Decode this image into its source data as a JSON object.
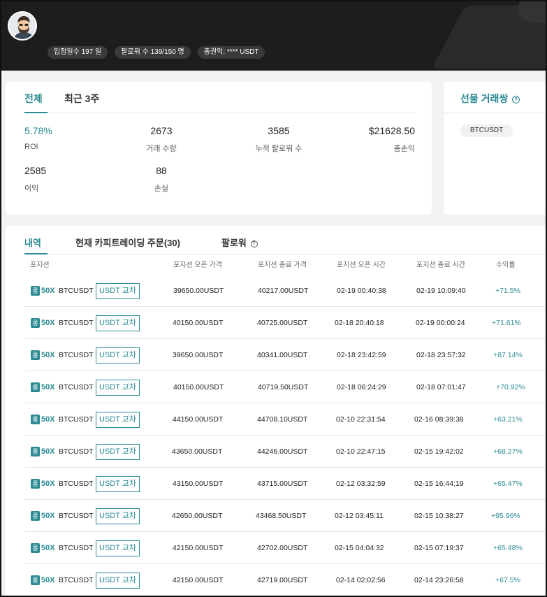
{
  "header": {
    "badges": [
      "입점일수 197 일",
      "팔로워 수 139/150 명",
      "총권익:  **** USDT"
    ]
  },
  "stats": {
    "tabs": [
      "전체",
      "최근 3주"
    ],
    "items": [
      {
        "value": "5.78%",
        "label": "ROI"
      },
      {
        "value": "2673",
        "label": "거래 수량"
      },
      {
        "value": "3585",
        "label": "누적 팔로워 수"
      },
      {
        "value": "$21628.50",
        "label": "총손익"
      },
      {
        "value": "2585",
        "label": "이익"
      },
      {
        "value": "88",
        "label": "손실"
      }
    ]
  },
  "pairs": {
    "title": "선물 거래쌍",
    "help_icon": "?",
    "chips": [
      "BTCUSDT"
    ]
  },
  "history": {
    "tabs": [
      "내역",
      "현재 카피트레이딩 주문(30)",
      "팔로워"
    ],
    "help_icon": "?",
    "columns": [
      "포지션",
      "포지션 오픈 가격",
      "포지션 종료 가격",
      "포지션 오픈 시간",
      "포지션 종료 시간",
      "수익률"
    ],
    "rows": [
      {
        "side": "롱",
        "leverage": "50X",
        "symbol": "BTCUSDT",
        "margin": "USDT 교차",
        "open_price": "39650.00USDT",
        "close_price": "40217.00USDT",
        "open_time": "02-19 00:40:38",
        "close_time": "02-19 10:09:40",
        "pnl": "+71.5%"
      },
      {
        "side": "롱",
        "leverage": "50X",
        "symbol": "BTCUSDT",
        "margin": "USDT 교차",
        "open_price": "40150.00USDT",
        "close_price": "40725.00USDT",
        "open_time": "02-18 20:40:18",
        "close_time": "02-19 00:00:24",
        "pnl": "+71.61%"
      },
      {
        "side": "롱",
        "leverage": "50X",
        "symbol": "BTCUSDT",
        "margin": "USDT 교차",
        "open_price": "39650.00USDT",
        "close_price": "40341.00USDT",
        "open_time": "02-18 23:42:59",
        "close_time": "02-18 23:57:32",
        "pnl": "+87.14%"
      },
      {
        "side": "롱",
        "leverage": "50X",
        "symbol": "BTCUSDT",
        "margin": "USDT 교차",
        "open_price": "40150.00USDT",
        "close_price": "40719.50USDT",
        "open_time": "02-18 06:24:29",
        "close_time": "02-18 07:01:47",
        "pnl": "+70.92%"
      },
      {
        "side": "롱",
        "leverage": "50X",
        "symbol": "BTCUSDT",
        "margin": "USDT 교차",
        "open_price": "44150.00USDT",
        "close_price": "44708.10USDT",
        "open_time": "02-10 22:31:54",
        "close_time": "02-16 08:39:38",
        "pnl": "+63.21%"
      },
      {
        "side": "롱",
        "leverage": "50X",
        "symbol": "BTCUSDT",
        "margin": "USDT 교차",
        "open_price": "43650.00USDT",
        "close_price": "44246.00USDT",
        "open_time": "02-10 22:47:15",
        "close_time": "02-15 19:42:02",
        "pnl": "+68.27%"
      },
      {
        "side": "롱",
        "leverage": "50X",
        "symbol": "BTCUSDT",
        "margin": "USDT 교차",
        "open_price": "43150.00USDT",
        "close_price": "43715.00USDT",
        "open_time": "02-12 03:32:59",
        "close_time": "02-15 16:44:19",
        "pnl": "+65.47%"
      },
      {
        "side": "롱",
        "leverage": "50X",
        "symbol": "BTCUSDT",
        "margin": "USDT 교차",
        "open_price": "42650.00USDT",
        "close_price": "43468.50USDT",
        "open_time": "02-12 03:45:11",
        "close_time": "02-15 10:38:27",
        "pnl": "+95.96%"
      },
      {
        "side": "롱",
        "leverage": "50X",
        "symbol": "BTCUSDT",
        "margin": "USDT 교차",
        "open_price": "42150.00USDT",
        "close_price": "42702.00USDT",
        "open_time": "02-15 04:04:32",
        "close_time": "02-15 07:19:37",
        "pnl": "+65.48%"
      },
      {
        "side": "롱",
        "leverage": "50X",
        "symbol": "BTCUSDT",
        "margin": "USDT 교차",
        "open_price": "42150.00USDT",
        "close_price": "42719.00USDT",
        "open_time": "02-14 02:02:56",
        "close_time": "02-14 23:26:58",
        "pnl": "+67.5%"
      }
    ]
  }
}
